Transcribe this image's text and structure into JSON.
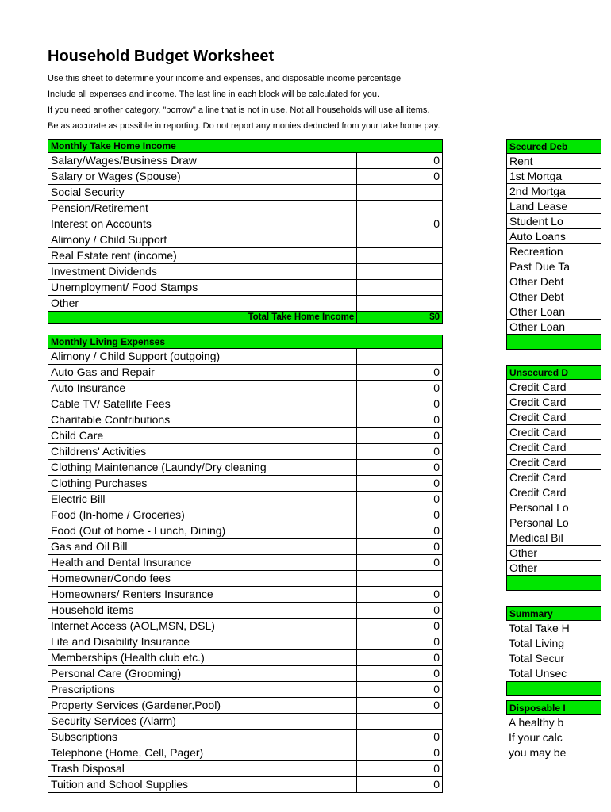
{
  "title": "Household Budget Worksheet",
  "intro": [
    "Use this sheet to determine your income and expenses, and disposable income percentage",
    "Include all expenses and income. The last line in each block will be calculated for you.",
    "If you need another category, \"borrow\" a line that is not in use. Not all households will use all items.",
    "Be as accurate as possible in reporting. Do not report any monies deducted from your take home pay."
  ],
  "income": {
    "header": "Monthly Take Home Income",
    "rows": [
      {
        "label": "Salary/Wages/Business Draw",
        "value": "0"
      },
      {
        "label": "Salary or Wages (Spouse)",
        "value": "0"
      },
      {
        "label": "Social Security",
        "value": ""
      },
      {
        "label": "Pension/Retirement",
        "value": ""
      },
      {
        "label": "Interest on Accounts",
        "value": "0"
      },
      {
        "label": "Alimony / Child Support",
        "value": ""
      },
      {
        "label": "Real Estate rent (income)",
        "value": ""
      },
      {
        "label": "Investment Dividends",
        "value": ""
      },
      {
        "label": "Unemployment/ Food Stamps",
        "value": ""
      },
      {
        "label": "Other",
        "value": ""
      }
    ],
    "total_label": "Total Take Home Income",
    "total_value": "$0"
  },
  "expenses": {
    "header": "Monthly Living Expenses",
    "rows": [
      {
        "label": "Alimony / Child Support (outgoing)",
        "value": ""
      },
      {
        "label": "Auto Gas and Repair",
        "value": "0"
      },
      {
        "label": "Auto Insurance",
        "value": "0"
      },
      {
        "label": "Cable TV/ Satellite Fees",
        "value": "0"
      },
      {
        "label": "Charitable Contributions",
        "value": "0"
      },
      {
        "label": "Child Care",
        "value": "0"
      },
      {
        "label": "Childrens' Activities",
        "value": "0"
      },
      {
        "label": "Clothing Maintenance (Laundy/Dry cleaning",
        "value": "0"
      },
      {
        "label": "Clothing Purchases",
        "value": "0"
      },
      {
        "label": "Electric Bill",
        "value": "0"
      },
      {
        "label": "Food (In-home / Groceries)",
        "value": "0"
      },
      {
        "label": "Food (Out of home - Lunch, Dining)",
        "value": "0"
      },
      {
        "label": "Gas and Oil Bill",
        "value": "0"
      },
      {
        "label": "Health and Dental Insurance",
        "value": "0"
      },
      {
        "label": "Homeowner/Condo fees",
        "value": ""
      },
      {
        "label": "Homeowners/ Renters Insurance",
        "value": "0"
      },
      {
        "label": "Household items",
        "value": "0"
      },
      {
        "label": "Internet Access (AOL,MSN, DSL)",
        "value": "0"
      },
      {
        "label": "Life and Disability Insurance",
        "value": "0"
      },
      {
        "label": "Memberships (Health club etc.)",
        "value": "0"
      },
      {
        "label": "Personal Care (Grooming)",
        "value": "0"
      },
      {
        "label": "Prescriptions",
        "value": "0"
      },
      {
        "label": "Property Services (Gardener,Pool)",
        "value": "0"
      },
      {
        "label": "Security Services (Alarm)",
        "value": ""
      },
      {
        "label": "Subscriptions",
        "value": "0"
      },
      {
        "label": "Telephone (Home, Cell, Pager)",
        "value": "0"
      },
      {
        "label": "Trash Disposal",
        "value": "0"
      },
      {
        "label": "Tuition and School Supplies",
        "value": "0"
      }
    ]
  },
  "secured": {
    "header": "Secured Deb",
    "rows": [
      "Rent",
      "1st Mortga",
      "2nd Mortga",
      "Land Lease",
      "Student Lo",
      "Auto Loans",
      "Recreation",
      "Past Due Ta",
      "Other Debt",
      "Other Debt",
      "Other Loan",
      "Other Loan"
    ]
  },
  "unsecured": {
    "header": "Unsecured D",
    "rows": [
      "Credit Card",
      "Credit Card",
      "Credit Card",
      "Credit Card",
      "Credit Card",
      "Credit Card",
      "Credit Card",
      "Credit Card",
      "Personal Lo",
      "Personal Lo",
      "Medical Bil",
      "Other",
      "Other"
    ]
  },
  "summary": {
    "header": "Summary",
    "rows": [
      "Total Take H",
      "Total Living",
      "Total Secur",
      "Total Unsec"
    ]
  },
  "disposable": {
    "header": "Disposable I",
    "rows": [
      "A healthy b",
      "If your calc",
      "you may be"
    ]
  }
}
